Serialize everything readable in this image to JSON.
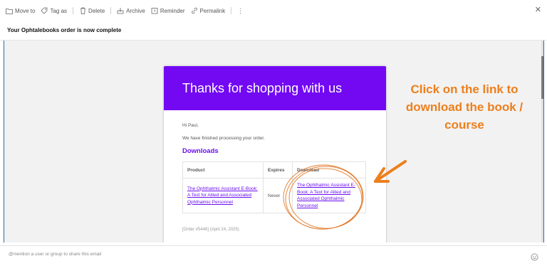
{
  "toolbar": {
    "move_to": "Move to",
    "tag_as": "Tag as",
    "delete": "Delete",
    "archive": "Archive",
    "reminder": "Reminder",
    "permalink": "Permalink"
  },
  "subject": "Your Ophtalebooks order is now complete",
  "email": {
    "header_title": "Thanks for shopping with us",
    "greeting": "Hi Paul,",
    "processing_text": "We have finished processing your order.",
    "downloads_heading": "Downloads",
    "table": {
      "headers": [
        "Product",
        "Expires",
        "Download"
      ],
      "row": {
        "product": "The Ophthalmic Assistant E-Book: A Text for Allied and Associated Ophthalmic Personnel",
        "expires": "Never",
        "download": "The Ophthalmic Assistant E-Book: A Text for Allied and Associated Ophthalmic Personnel"
      }
    },
    "truncated_line": "[Order #5446] (April 24, 2025)"
  },
  "annotation": "Click on the link to download the book / course",
  "share": {
    "placeholder": "@mention a user or group to share this email"
  },
  "colors": {
    "header_purple": "#7209f2",
    "link_purple": "#6a0ef0",
    "annotation_orange": "#ed7f1d"
  },
  "icons": [
    "folder-icon",
    "tag-icon",
    "trash-icon",
    "archive-icon",
    "alarm-clock-icon",
    "link-icon",
    "more-vertical-icon",
    "close-icon",
    "emoji-icon"
  ]
}
